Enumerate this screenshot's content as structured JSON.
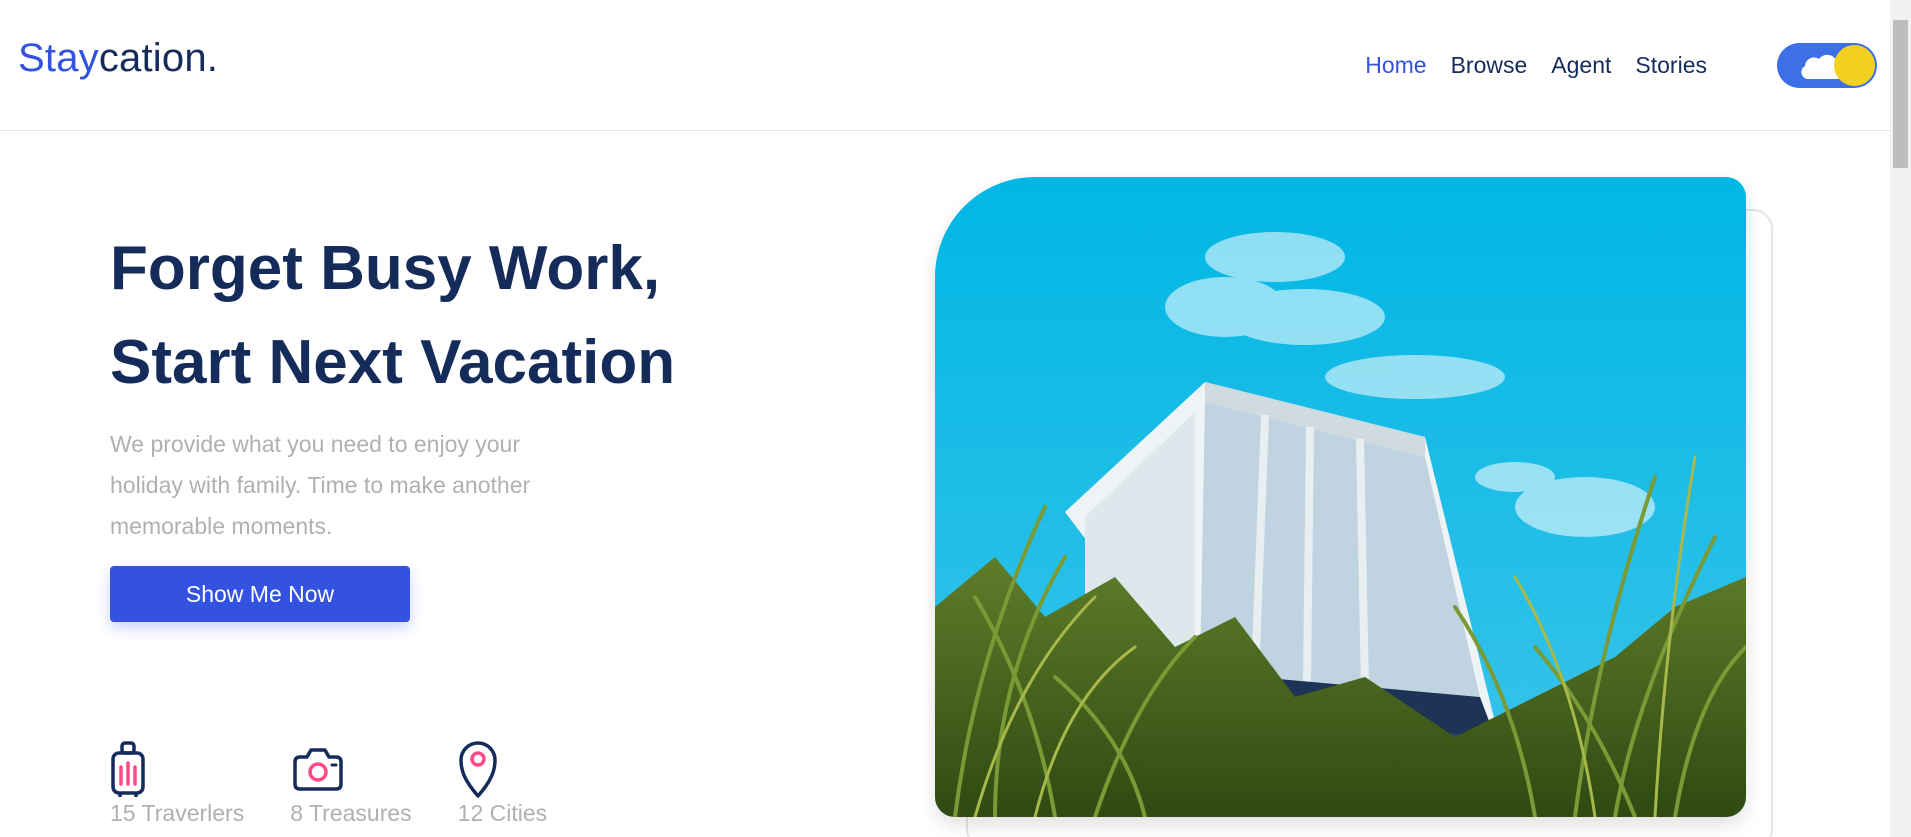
{
  "header": {
    "logo_part1": "Stay",
    "logo_part2": "cation.",
    "nav": [
      {
        "label": "Home",
        "active": true
      },
      {
        "label": "Browse",
        "active": false
      },
      {
        "label": "Agent",
        "active": false
      },
      {
        "label": "Stories",
        "active": false
      }
    ],
    "theme_toggle": {
      "icon_left": "cloud-icon",
      "icon_right": "sun-icon"
    }
  },
  "hero": {
    "title_line1": "Forget Busy Work,",
    "title_line2": "Start Next Vacation",
    "description": "We provide what you need to enjoy your holiday with family. Time to make another memorable moments.",
    "cta_label": "Show Me Now",
    "stats": [
      {
        "icon": "suitcase-icon",
        "label": "15 Traverlers"
      },
      {
        "icon": "camera-icon",
        "label": "8 Treasures"
      },
      {
        "icon": "map-pin-icon",
        "label": "12 Cities"
      }
    ]
  },
  "colors": {
    "primary": "#3252DF",
    "navy": "#152C5B",
    "muted": "#B0B0B0",
    "accent_pink": "#FF498B",
    "toggle_sun": "#F2D21F"
  }
}
